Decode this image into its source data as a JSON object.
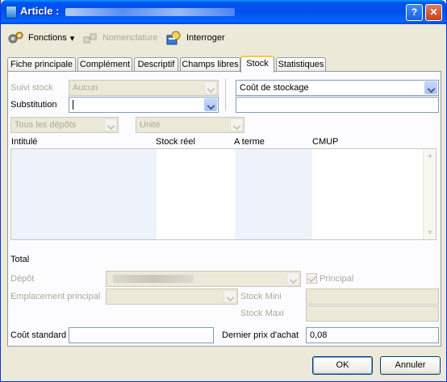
{
  "window": {
    "title": "Article :",
    "help_label": "?",
    "close_label": "✕"
  },
  "toolbar": {
    "functions": "Fonctions",
    "functions_arrow": "▾",
    "nomenclature": "Nomenclature",
    "query": "Interroger"
  },
  "tabs": [
    "Fiche principale",
    "Complément",
    "Descriptif",
    "Champs libres",
    "Stock",
    "Statistiques"
  ],
  "active_tab": "Stock",
  "stock": {
    "suivi_label": "Suivi stock",
    "suivi_value": "Aucun",
    "substitution_label": "Substitution",
    "substitution_value": "",
    "storage_cost_value": "Coût de stockage",
    "storage_cost_input": "",
    "depots_filter": "Tous les dépôts",
    "unit_filter": "Unité",
    "grid_headers": [
      "Intitulé",
      "Stock réel",
      "A terme",
      "CMUP"
    ],
    "total_label": "Total",
    "depot_label": "Dépôt",
    "principal_label": "Principal",
    "emplacement_label": "Emplacement principal",
    "stock_mini_label": "Stock Mini",
    "stock_maxi_label": "Stock Maxi",
    "cout_standard_label": "Coût standard",
    "cout_standard_value": "",
    "dernier_prix_label": "Dernier prix d'achat",
    "dernier_prix_value": "0,08"
  },
  "buttons": {
    "ok": "OK",
    "cancel": "Annuler"
  }
}
